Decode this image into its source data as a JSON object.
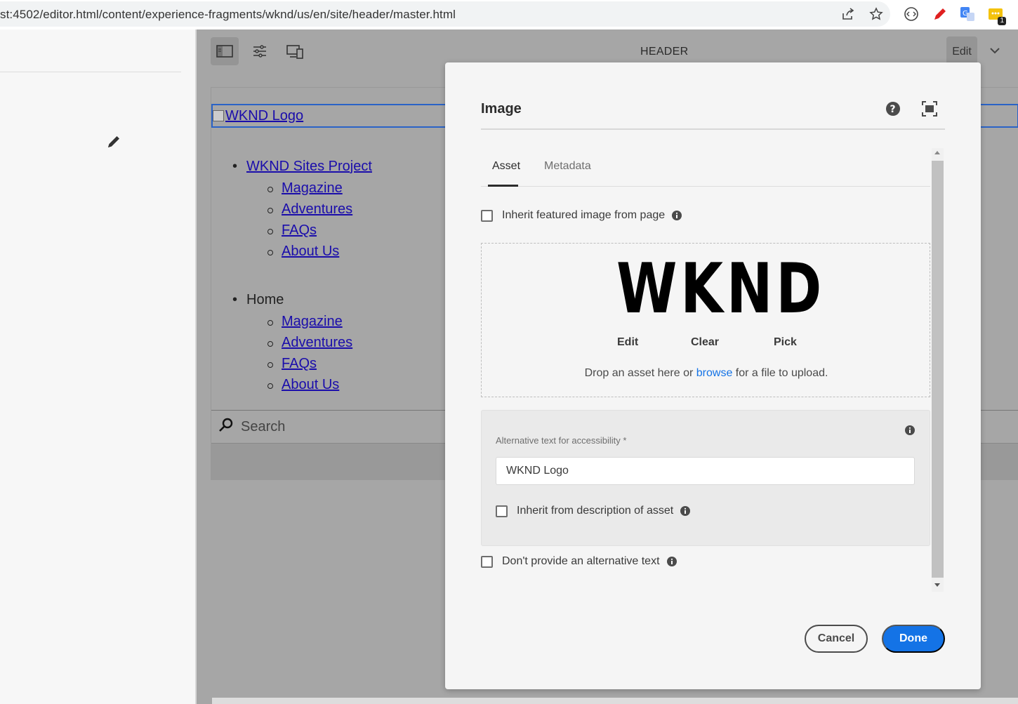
{
  "browser": {
    "url": "st:4502/editor.html/content/experience-fragments/wknd/us/en/site/header/master.html",
    "extension_badge": "1"
  },
  "editor": {
    "title": "HEADER",
    "edit_label": "Edit"
  },
  "page": {
    "logo_alt": "WKND Logo",
    "nav": [
      {
        "label": "WKND Sites Project",
        "link": true,
        "children": [
          "Magazine",
          "Adventures",
          "FAQs",
          "About Us"
        ]
      },
      {
        "label": "Home",
        "link": false,
        "children": [
          "Magazine",
          "Adventures",
          "FAQs",
          "About Us"
        ]
      }
    ],
    "search_placeholder": "Search"
  },
  "dialog": {
    "title": "Image",
    "tabs": [
      "Asset",
      "Metadata"
    ],
    "inherit_featured_label": "Inherit featured image from page",
    "asset_text": "WKND",
    "asset_actions": [
      "Edit",
      "Clear",
      "Pick"
    ],
    "drop_before": "Drop an asset here or ",
    "drop_link": "browse",
    "drop_after": " for a file to upload.",
    "alt_label": "Alternative text for accessibility *",
    "alt_value": "WKND Logo",
    "inherit_desc_label": "Inherit from description of asset",
    "no_alt_label": "Don't provide an alternative text",
    "cancel_label": "Cancel",
    "done_label": "Done"
  },
  "colors": {
    "accent": "#1473e6",
    "overlay": "#a6a6a6",
    "dialog_bg": "#f5f5f5"
  }
}
